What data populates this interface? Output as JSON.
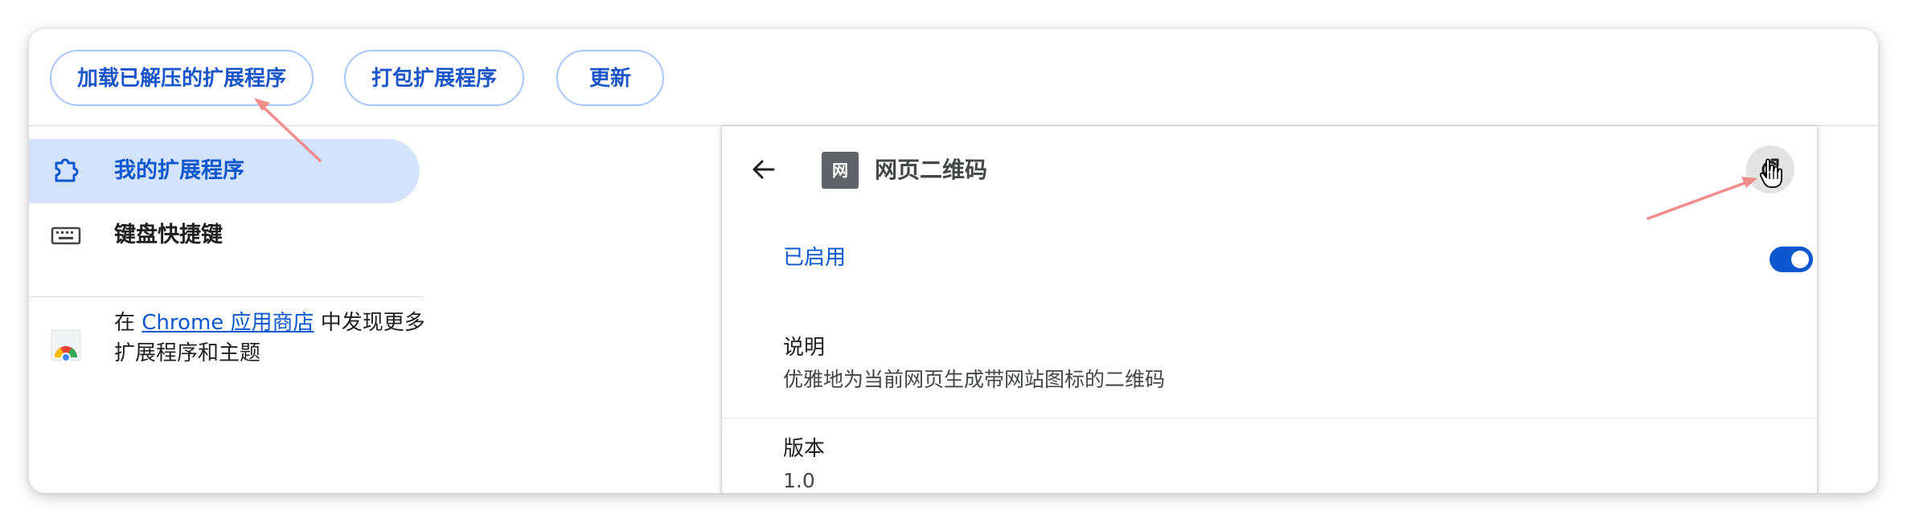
{
  "toolbar": {
    "load_unpacked_label": "加载已解压的扩展程序",
    "pack_label": "打包扩展程序",
    "update_label": "更新"
  },
  "sidebar": {
    "items": [
      {
        "label": "我的扩展程序",
        "icon": "puzzle-icon",
        "active": true
      },
      {
        "label": "键盘快捷键",
        "icon": "keyboard-icon",
        "active": false
      }
    ],
    "store_prefix": "在",
    "store_link": "Chrome 应用商店",
    "store_suffix": "中发现更多扩展程序和主题",
    "store_icon": "chrome-web-store-icon"
  },
  "detail": {
    "back_icon": "arrow-left-icon",
    "badge_text": "网",
    "name": "网页二维码",
    "reload_icon": "reload-icon",
    "enabled_label": "已启用",
    "enabled": true,
    "description_title": "说明",
    "description": "优雅地为当前网页生成带网站图标的二维码",
    "version_title": "版本",
    "version": "1.0"
  },
  "colors": {
    "accent": "#0b57d0",
    "active_bg": "#d3e3fd",
    "button_border": "#a8c7fa",
    "annotation_arrow": "#f08c8c"
  }
}
